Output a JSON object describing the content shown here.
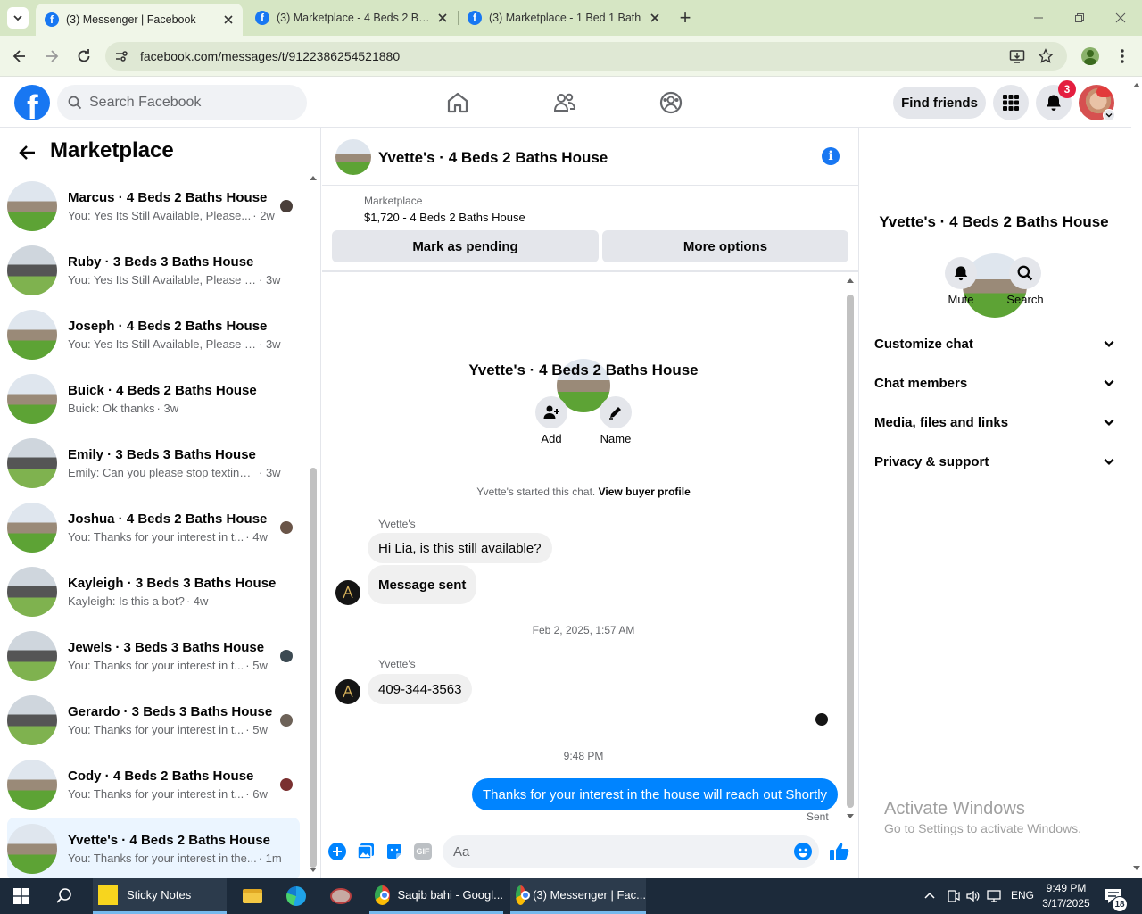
{
  "browser": {
    "tabs": [
      {
        "title": "(3) Messenger | Facebook",
        "active": true
      },
      {
        "title": "(3) Marketplace - 4 Beds 2 Bath",
        "active": false
      },
      {
        "title": "(3) Marketplace - 1 Bed 1 Bath",
        "active": false
      }
    ],
    "url": "facebook.com/messages/t/9122386254521880",
    "new_tab_symbol": "+"
  },
  "header": {
    "search_placeholder": "Search Facebook",
    "find_friends": "Find friends",
    "notification_count": "3"
  },
  "sidebar": {
    "title": "Marketplace",
    "conversations": [
      {
        "name": "Marcus · 4 Beds 2 Baths House",
        "preview": "You: Yes Its Still Available, Please...",
        "time": "· 2w",
        "selected": false
      },
      {
        "name": "Ruby · 3 Beds 3 Baths House",
        "preview": "You: Yes Its Still Available, Please Se...",
        "time": "· 3w",
        "selected": false
      },
      {
        "name": "Joseph · 4 Beds 2 Baths House",
        "preview": "You: Yes Its Still Available, Please Se...",
        "time": "· 3w",
        "selected": false
      },
      {
        "name": "Buick · 4 Beds 2 Baths House",
        "preview": "Buick: Ok thanks",
        "time": "· 3w",
        "selected": false
      },
      {
        "name": "Emily · 3 Beds 3 Baths House",
        "preview": "Emily: Can you please stop texting ...",
        "time": "· 3w",
        "selected": false
      },
      {
        "name": "Joshua · 4 Beds 2 Baths House",
        "preview": "You: Thanks for your interest in t...",
        "time": "· 4w",
        "selected": false
      },
      {
        "name": "Kayleigh · 3 Beds 3 Baths House",
        "preview": "Kayleigh: Is this a bot?",
        "time": "· 4w",
        "selected": false
      },
      {
        "name": "Jewels · 3 Beds 3 Baths House",
        "preview": "You: Thanks for your interest in t...",
        "time": "· 5w",
        "selected": false
      },
      {
        "name": "Gerardo · 3 Beds 3 Baths House",
        "preview": "You: Thanks for your interest in t...",
        "time": "· 5w",
        "selected": false
      },
      {
        "name": "Cody · 4 Beds 2 Baths House",
        "preview": "You: Thanks for your interest in t...",
        "time": "· 6w",
        "selected": false
      },
      {
        "name": "Yvette's · 4 Beds 2 Baths House",
        "preview": "You: Thanks for your interest in the...",
        "time": "· 1m",
        "selected": true
      }
    ]
  },
  "chat": {
    "title": "Yvette's · 4 Beds 2 Baths House",
    "listing_label": "Marketplace",
    "listing_price": "$1,720 - 4 Beds 2 Baths House",
    "mark_pending": "Mark as pending",
    "more_options": "More options",
    "profile_name": "Yvette's · 4 Beds 2 Baths House",
    "add_label": "Add",
    "name_label": "Name",
    "started_text": "Yvette's started this chat.",
    "view_buyer_profile": "View buyer profile",
    "sender_1": "Yvette's",
    "msg_1": "Hi Lia, is this still available?",
    "msg_2": "Message sent",
    "timestamp_1": "Feb 2, 2025, 1:57 AM",
    "sender_2": "Yvette's",
    "msg_3": "409-344-3563",
    "timestamp_2": "9:48 PM",
    "msg_me": "Thanks for your interest in the house will reach out Shortly",
    "sent_status": "Sent",
    "composer_placeholder": "Aa"
  },
  "details": {
    "name": "Yvette's · 4 Beds 2 Baths House",
    "mute": "Mute",
    "search": "Search",
    "sections": [
      "Customize chat",
      "Chat members",
      "Media, files and links",
      "Privacy & support"
    ]
  },
  "watermark": {
    "line1": "Activate Windows",
    "line2": "Go to Settings to activate Windows."
  },
  "taskbar": {
    "sticky_notes": "Sticky Notes",
    "chrome_1": "Saqib bahi - Googl...",
    "chrome_2": "(3) Messenger | Fac...",
    "language": "ENG",
    "time": "9:49 PM",
    "date": "3/17/2025",
    "notifications": "18"
  },
  "colors": {
    "fb_blue": "#1877f2",
    "messenger_blue": "#0084ff",
    "chrome_green": "#d6e6c4",
    "badge_red": "#e41e3f"
  }
}
